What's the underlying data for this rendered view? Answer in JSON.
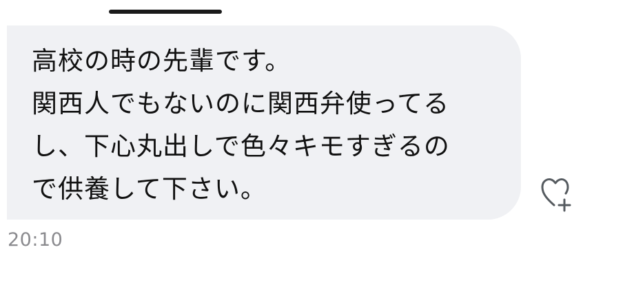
{
  "message": {
    "lines": [
      "高校の時の先輩です。",
      "関西人でもないのに関西弁使ってる",
      "し、下心丸出しで色々キモすぎるの",
      "で供養して下さい。"
    ],
    "time": "20:10"
  },
  "icons": {
    "reaction": "heart-plus-icon",
    "top_bar": "drag-handle"
  },
  "colors": {
    "bubble_background": "#f0f1f4",
    "text": "#111111",
    "timestamp": "#8a8a8e",
    "icon": "#555a5f"
  }
}
